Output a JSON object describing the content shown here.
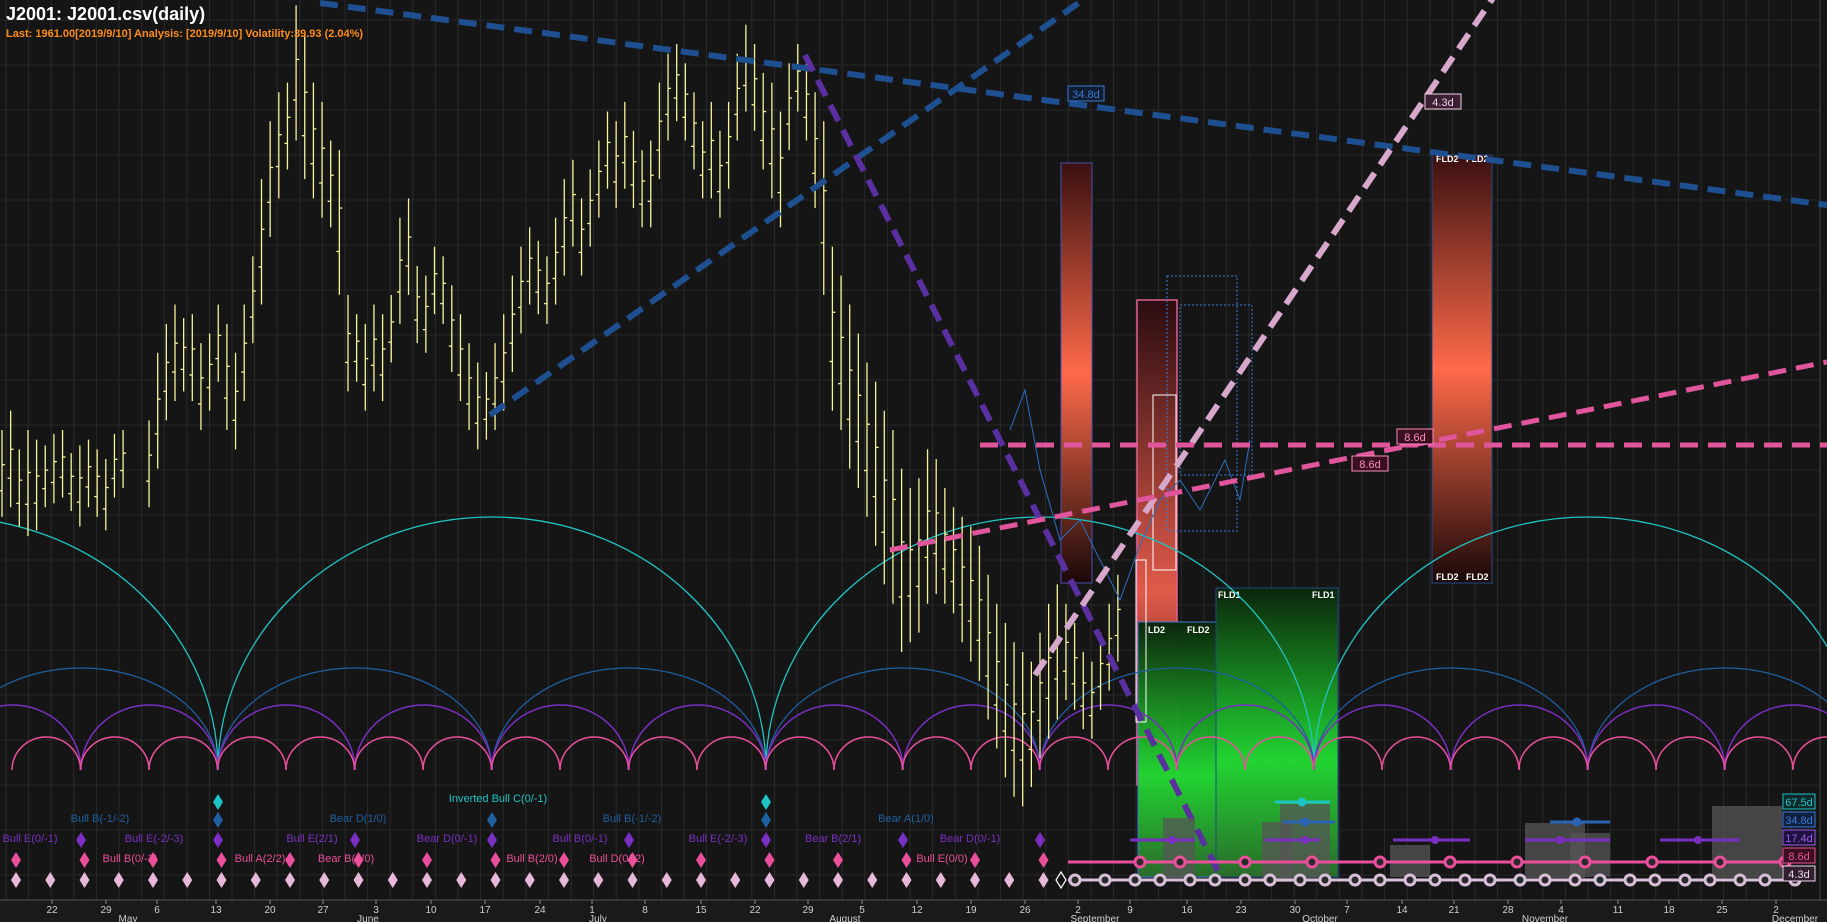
{
  "title": "J2001: J2001.csv(daily)",
  "info_line": "Last: 1961.00[2019/9/10] Analysis: [2019/9/10] Volatility:39.93 (2.04%)",
  "colors": {
    "background": "#151515",
    "price_bars": "#f5f59b",
    "cycle_67": "#1fc4c4",
    "cycle_35": "#1e5fa0",
    "cycle_17": "#7a2fc2",
    "cycle_9": "#ea4f9c",
    "cycle_4": "#e0b0d0",
    "fld_red": "#ff6a4a",
    "fld_green": "#22dd33"
  },
  "chart_data": {
    "type": "bar",
    "series_type": "ohlc",
    "x_axis": {
      "days": [
        "22",
        "29",
        "6",
        "13",
        "20",
        "27",
        "3",
        "10",
        "17",
        "24",
        "1",
        "8",
        "15",
        "22",
        "29",
        "5",
        "12",
        "19",
        "26",
        "2",
        "9",
        "16",
        "23",
        "30",
        "7",
        "14",
        "21",
        "28",
        "4",
        "11",
        "18",
        "25",
        "2"
      ],
      "months": [
        "May",
        "June",
        "July",
        "August",
        "September",
        "October",
        "November",
        "December"
      ]
    },
    "price_bars": [
      [
        0,
        1880,
        1835
      ],
      [
        1,
        1890,
        1840
      ],
      [
        2,
        1870,
        1830
      ],
      [
        3,
        1880,
        1825
      ],
      [
        4,
        1875,
        1828
      ],
      [
        5,
        1872,
        1840
      ],
      [
        6,
        1878,
        1842
      ],
      [
        7,
        1880,
        1845
      ],
      [
        8,
        1868,
        1838
      ],
      [
        9,
        1872,
        1830
      ],
      [
        10,
        1875,
        1840
      ],
      [
        11,
        1870,
        1835
      ],
      [
        12,
        1865,
        1828
      ],
      [
        13,
        1878,
        1845
      ],
      [
        14,
        1880,
        1850
      ],
      [
        17,
        1885,
        1840
      ],
      [
        18,
        1920,
        1860
      ],
      [
        19,
        1935,
        1885
      ],
      [
        20,
        1945,
        1895
      ],
      [
        21,
        1938,
        1900
      ],
      [
        22,
        1940,
        1895
      ],
      [
        23,
        1925,
        1880
      ],
      [
        24,
        1930,
        1890
      ],
      [
        25,
        1945,
        1905
      ],
      [
        26,
        1935,
        1880
      ],
      [
        27,
        1920,
        1870
      ],
      [
        28,
        1945,
        1895
      ],
      [
        29,
        1970,
        1925
      ],
      [
        30,
        2010,
        1945
      ],
      [
        31,
        2040,
        1980
      ],
      [
        32,
        2055,
        2000
      ],
      [
        33,
        2060,
        2015
      ],
      [
        34,
        2100,
        2030
      ],
      [
        35,
        2085,
        2010
      ],
      [
        36,
        2060,
        2000
      ],
      [
        37,
        2050,
        1990
      ],
      [
        38,
        2030,
        1985
      ],
      [
        39,
        2025,
        1950
      ],
      [
        40,
        1950,
        1900
      ],
      [
        41,
        1940,
        1905
      ],
      [
        42,
        1935,
        1890
      ],
      [
        43,
        1945,
        1900
      ],
      [
        44,
        1940,
        1895
      ],
      [
        45,
        1950,
        1915
      ],
      [
        46,
        1990,
        1935
      ],
      [
        47,
        2000,
        1950
      ],
      [
        48,
        1965,
        1925
      ],
      [
        49,
        1960,
        1920
      ],
      [
        50,
        1975,
        1940
      ],
      [
        51,
        1970,
        1935
      ],
      [
        52,
        1955,
        1910
      ],
      [
        53,
        1940,
        1895
      ],
      [
        54,
        1925,
        1880
      ],
      [
        55,
        1915,
        1870
      ],
      [
        56,
        1910,
        1875
      ],
      [
        57,
        1925,
        1880
      ],
      [
        58,
        1940,
        1890
      ],
      [
        59,
        1960,
        1910
      ],
      [
        60,
        1975,
        1930
      ],
      [
        61,
        1985,
        1945
      ],
      [
        62,
        1978,
        1940
      ],
      [
        63,
        1970,
        1935
      ],
      [
        64,
        1990,
        1945
      ],
      [
        65,
        2010,
        1960
      ],
      [
        66,
        2020,
        1975
      ],
      [
        67,
        2000,
        1960
      ],
      [
        68,
        2015,
        1975
      ],
      [
        69,
        2030,
        1990
      ],
      [
        70,
        2045,
        2005
      ],
      [
        71,
        2040,
        1995
      ],
      [
        72,
        2050,
        2005
      ],
      [
        73,
        2035,
        1995
      ],
      [
        74,
        2025,
        1985
      ],
      [
        75,
        2030,
        1985
      ],
      [
        76,
        2060,
        2010
      ],
      [
        77,
        2075,
        2030
      ],
      [
        78,
        2080,
        2040
      ],
      [
        79,
        2070,
        2030
      ],
      [
        80,
        2055,
        2015
      ],
      [
        81,
        2040,
        2000
      ],
      [
        82,
        2050,
        2000
      ],
      [
        83,
        2035,
        1990
      ],
      [
        84,
        2050,
        2005
      ],
      [
        85,
        2075,
        2030
      ],
      [
        86,
        2090,
        2045
      ],
      [
        87,
        2080,
        2035
      ],
      [
        88,
        2065,
        2015
      ],
      [
        89,
        2060,
        2000
      ],
      [
        90,
        2045,
        1985
      ],
      [
        91,
        2070,
        2025
      ],
      [
        92,
        2080,
        2045
      ],
      [
        93,
        2070,
        2030
      ],
      [
        94,
        2055,
        1995
      ],
      [
        95,
        2040,
        1950
      ],
      [
        96,
        1975,
        1890
      ],
      [
        97,
        1960,
        1880
      ],
      [
        98,
        1945,
        1860
      ],
      [
        99,
        1930,
        1850
      ],
      [
        100,
        1915,
        1835
      ],
      [
        101,
        1905,
        1820
      ],
      [
        102,
        1890,
        1800
      ],
      [
        103,
        1880,
        1790
      ],
      [
        104,
        1860,
        1765
      ],
      [
        105,
        1850,
        1770
      ],
      [
        106,
        1855,
        1775
      ],
      [
        107,
        1870,
        1790
      ],
      [
        108,
        1865,
        1795
      ],
      [
        109,
        1850,
        1790
      ],
      [
        110,
        1840,
        1785
      ],
      [
        111,
        1835,
        1770
      ],
      [
        112,
        1830,
        1760
      ],
      [
        113,
        1820,
        1750
      ],
      [
        114,
        1805,
        1730
      ],
      [
        115,
        1790,
        1715
      ],
      [
        116,
        1780,
        1700
      ],
      [
        117,
        1770,
        1690
      ],
      [
        118,
        1765,
        1685
      ],
      [
        119,
        1760,
        1695
      ],
      [
        120,
        1775,
        1710
      ],
      [
        121,
        1790,
        1720
      ],
      [
        122,
        1800,
        1730
      ],
      [
        123,
        1790,
        1740
      ],
      [
        124,
        1780,
        1735
      ],
      [
        125,
        1765,
        1725
      ],
      [
        126,
        1760,
        1720
      ],
      [
        127,
        1775,
        1735
      ],
      [
        128,
        1790,
        1745
      ],
      [
        129,
        1805,
        1760
      ]
    ],
    "fld_labels": [
      "FLD2",
      "FLD2",
      "FLD2",
      "FLD2",
      "LD2",
      "FLD2",
      "FLD1",
      "FLD1"
    ],
    "trend_line_labels": [
      "34.8d",
      "4.3d",
      "8.6d",
      "8.6d"
    ],
    "cycle_labels": [
      "67.5d",
      "34.8d",
      "17.4d",
      "8.6d",
      "4.3d"
    ],
    "phasing_labels": [
      {
        "text": "Bull B(-1/-2)",
        "c": "cycle_35"
      },
      {
        "text": "Bear D(1/0)",
        "c": "cycle_35"
      },
      {
        "text": "Bull B(-1/-2)",
        "c": "cycle_35"
      },
      {
        "text": "Bear A(1/0)",
        "c": "cycle_35"
      },
      {
        "text": "Inverted Bull C(0/-1)",
        "c": "cycle_67"
      },
      {
        "text": "Bull E(0/-1)",
        "c": "cycle_17"
      },
      {
        "text": "Bull E(-2/-3)",
        "c": "cycle_17"
      },
      {
        "text": "Bull E(2/1)",
        "c": "cycle_17"
      },
      {
        "text": "Bear D(0/-1)",
        "c": "cycle_17"
      },
      {
        "text": "Bull B(0/-1)",
        "c": "cycle_17"
      },
      {
        "text": "Bull E(-2/-3)",
        "c": "cycle_17"
      },
      {
        "text": "Bear B(2/1)",
        "c": "cycle_17"
      },
      {
        "text": "Bear D(0/-1)",
        "c": "cycle_17"
      },
      {
        "text": "Bull B(0/-2)",
        "c": "cycle_9"
      },
      {
        "text": "Bull A(2/2)",
        "c": "cycle_9"
      },
      {
        "text": "Bear B(0/0)",
        "c": "cycle_9"
      },
      {
        "text": "Bull B(2/0)",
        "c": "cycle_9"
      },
      {
        "text": "Bull D(0/-2)",
        "c": "cycle_9"
      },
      {
        "text": "Bull E(0/0)",
        "c": "cycle_9"
      }
    ]
  }
}
